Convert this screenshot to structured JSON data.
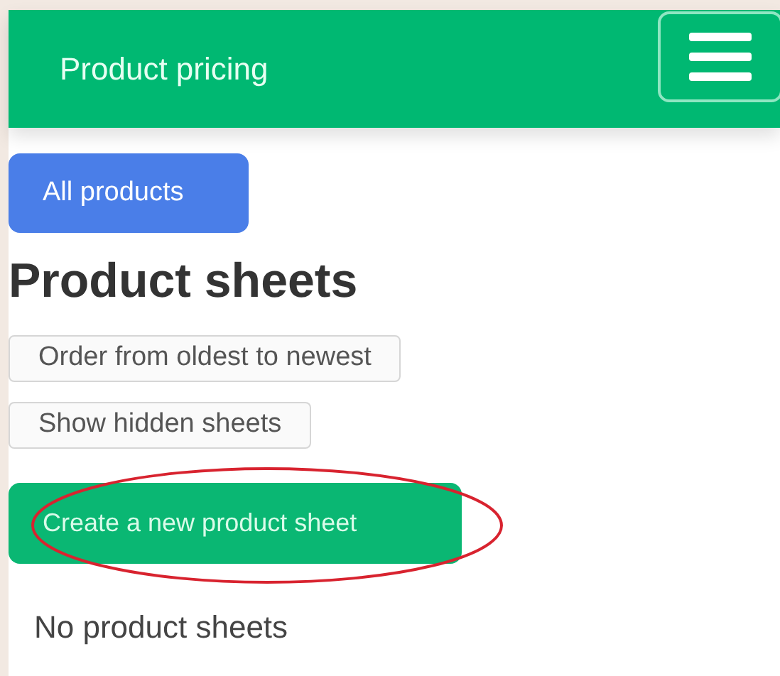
{
  "navbar": {
    "title": "Product pricing"
  },
  "nav_button": {
    "label": "All products",
    "kind": "primary"
  },
  "heading": "Product sheets",
  "options": [
    {
      "label": "Order from oldest to newest",
      "kind": "outline"
    },
    {
      "label": "Show hidden sheets",
      "kind": "outline"
    }
  ],
  "create_button": {
    "label": "Create a new product sheet",
    "kind": "success",
    "highlighted": true
  },
  "empty_message": "No product sheets"
}
